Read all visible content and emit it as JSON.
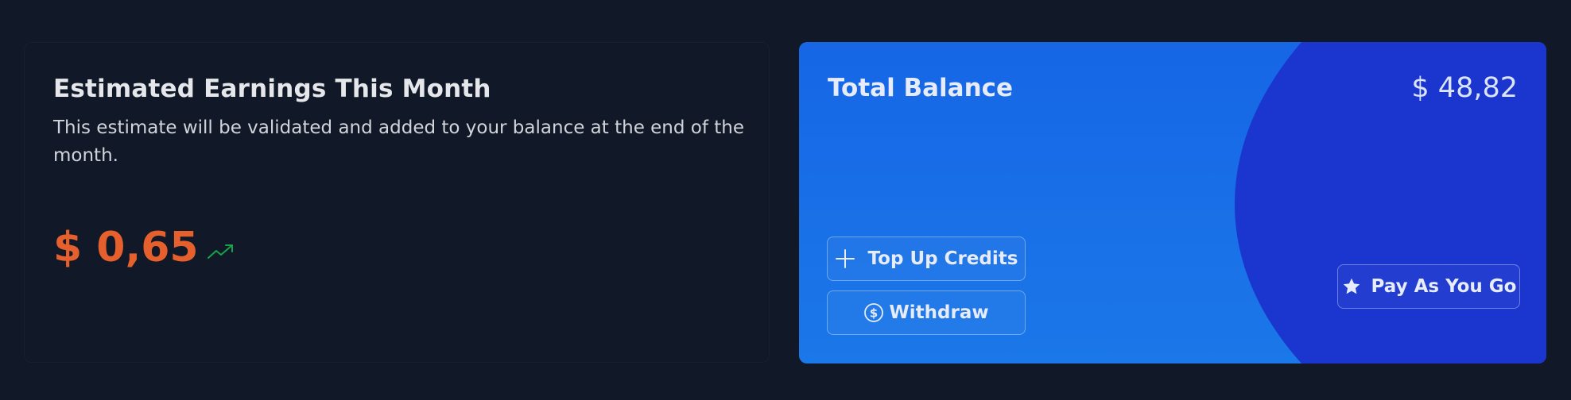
{
  "earnings": {
    "title": "Estimated Earnings This Month",
    "description": "This estimate will be validated and added to your balance at the end of the month.",
    "amount": "$ 0,65",
    "trend_icon": "trending-up-icon"
  },
  "balance": {
    "title": "Total Balance",
    "amount": "$ 48,82",
    "buttons": {
      "top_up": "Top Up Credits",
      "withdraw": "Withdraw",
      "pay_as_you_go": "Pay As You Go"
    },
    "icons": {
      "top_up": "plus-icon",
      "withdraw": "dollar-circle-icon",
      "pay_as_you_go": "star-icon"
    }
  },
  "colors": {
    "background": "#111827",
    "earnings_amount": "#e5602c",
    "trend": "#16a34a",
    "balance_card": "#1666e6",
    "balance_arc": "#1a36cf"
  }
}
